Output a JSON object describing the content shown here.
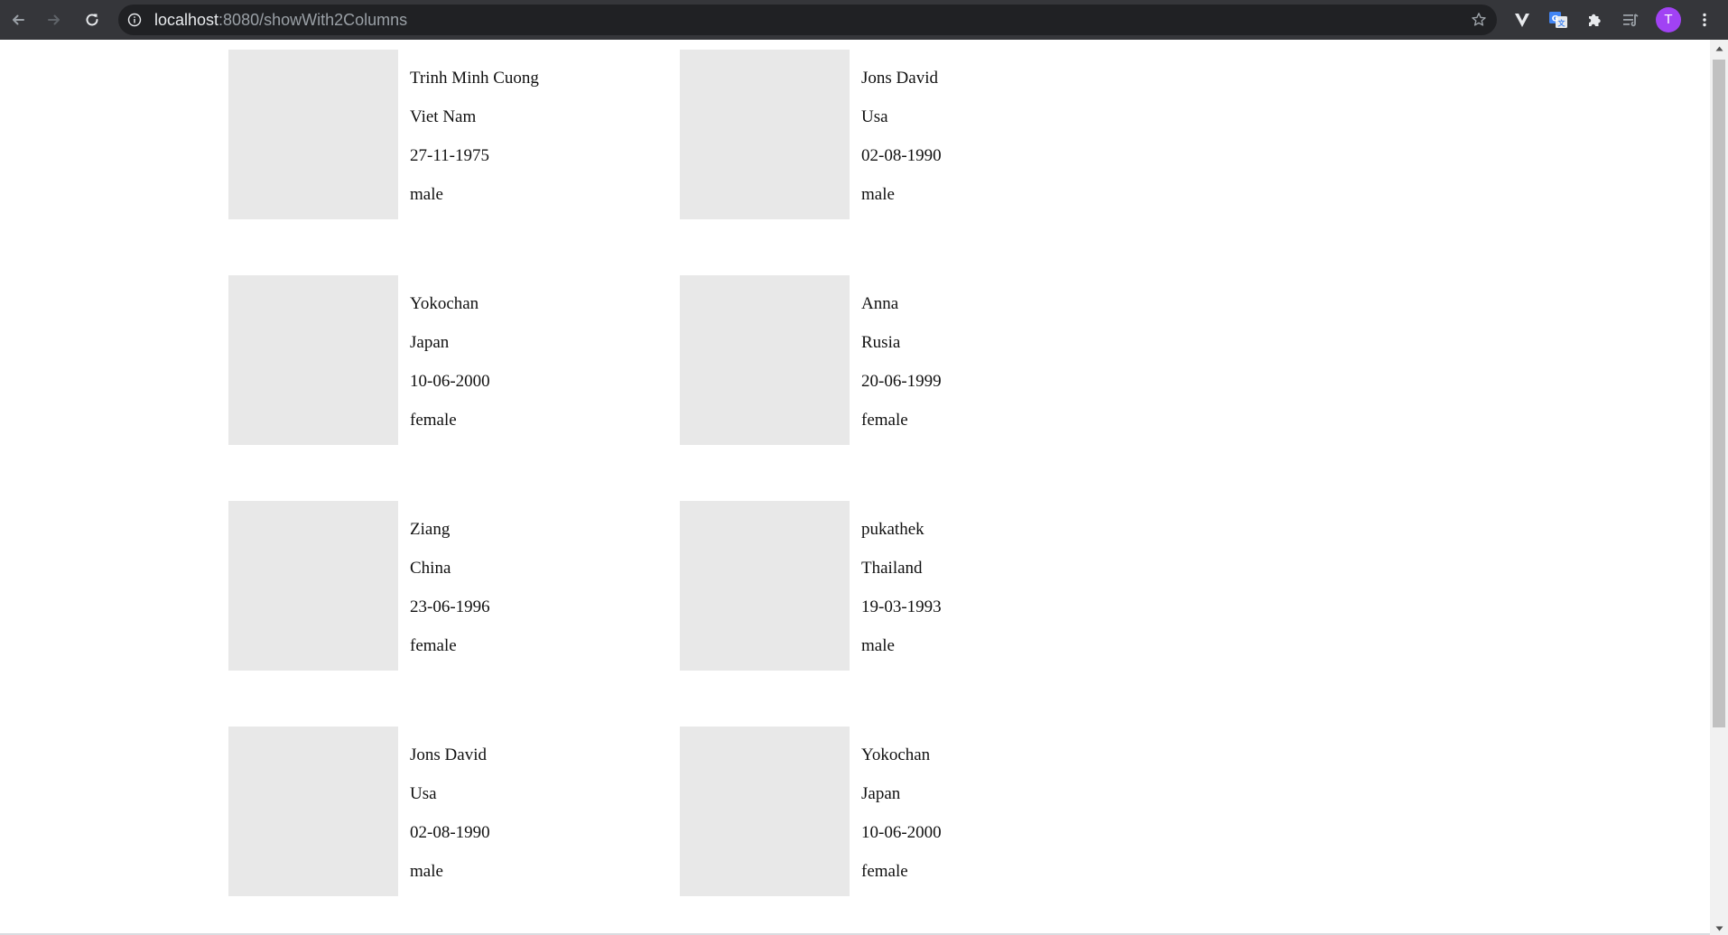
{
  "browser": {
    "url_host": "localhost",
    "url_path": ":8080/showWith2Columns",
    "profile_initial": "T",
    "icons": {
      "back": "arrow-left-icon",
      "forward": "arrow-right-icon",
      "reload": "reload-icon",
      "site_info": "info-icon",
      "bookmark": "star-icon",
      "extension_v": "v-extension-icon",
      "translate": "google-translate-icon",
      "extensions": "puzzle-icon",
      "reading_list": "reading-list-icon",
      "menu": "kebab-menu-icon"
    },
    "colors": {
      "toolbar": "#35363a",
      "omnibox": "#202124",
      "avatar": "#a142f4"
    }
  },
  "cards": [
    {
      "name": "Trinh Minh Cuong",
      "country": "Viet Nam",
      "dob": "27-11-1975",
      "gender": "male"
    },
    {
      "name": "Jons David",
      "country": "Usa",
      "dob": "02-08-1990",
      "gender": "male"
    },
    {
      "name": "Yokochan",
      "country": "Japan",
      "dob": "10-06-2000",
      "gender": "female"
    },
    {
      "name": "Anna",
      "country": "Rusia",
      "dob": "20-06-1999",
      "gender": "female"
    },
    {
      "name": "Ziang",
      "country": "China",
      "dob": "23-06-1996",
      "gender": "female"
    },
    {
      "name": "pukathek",
      "country": "Thailand",
      "dob": "19-03-1993",
      "gender": "male"
    },
    {
      "name": "Jons David",
      "country": "Usa",
      "dob": "02-08-1990",
      "gender": "male"
    },
    {
      "name": "Yokochan",
      "country": "Japan",
      "dob": "10-06-2000",
      "gender": "female"
    }
  ]
}
